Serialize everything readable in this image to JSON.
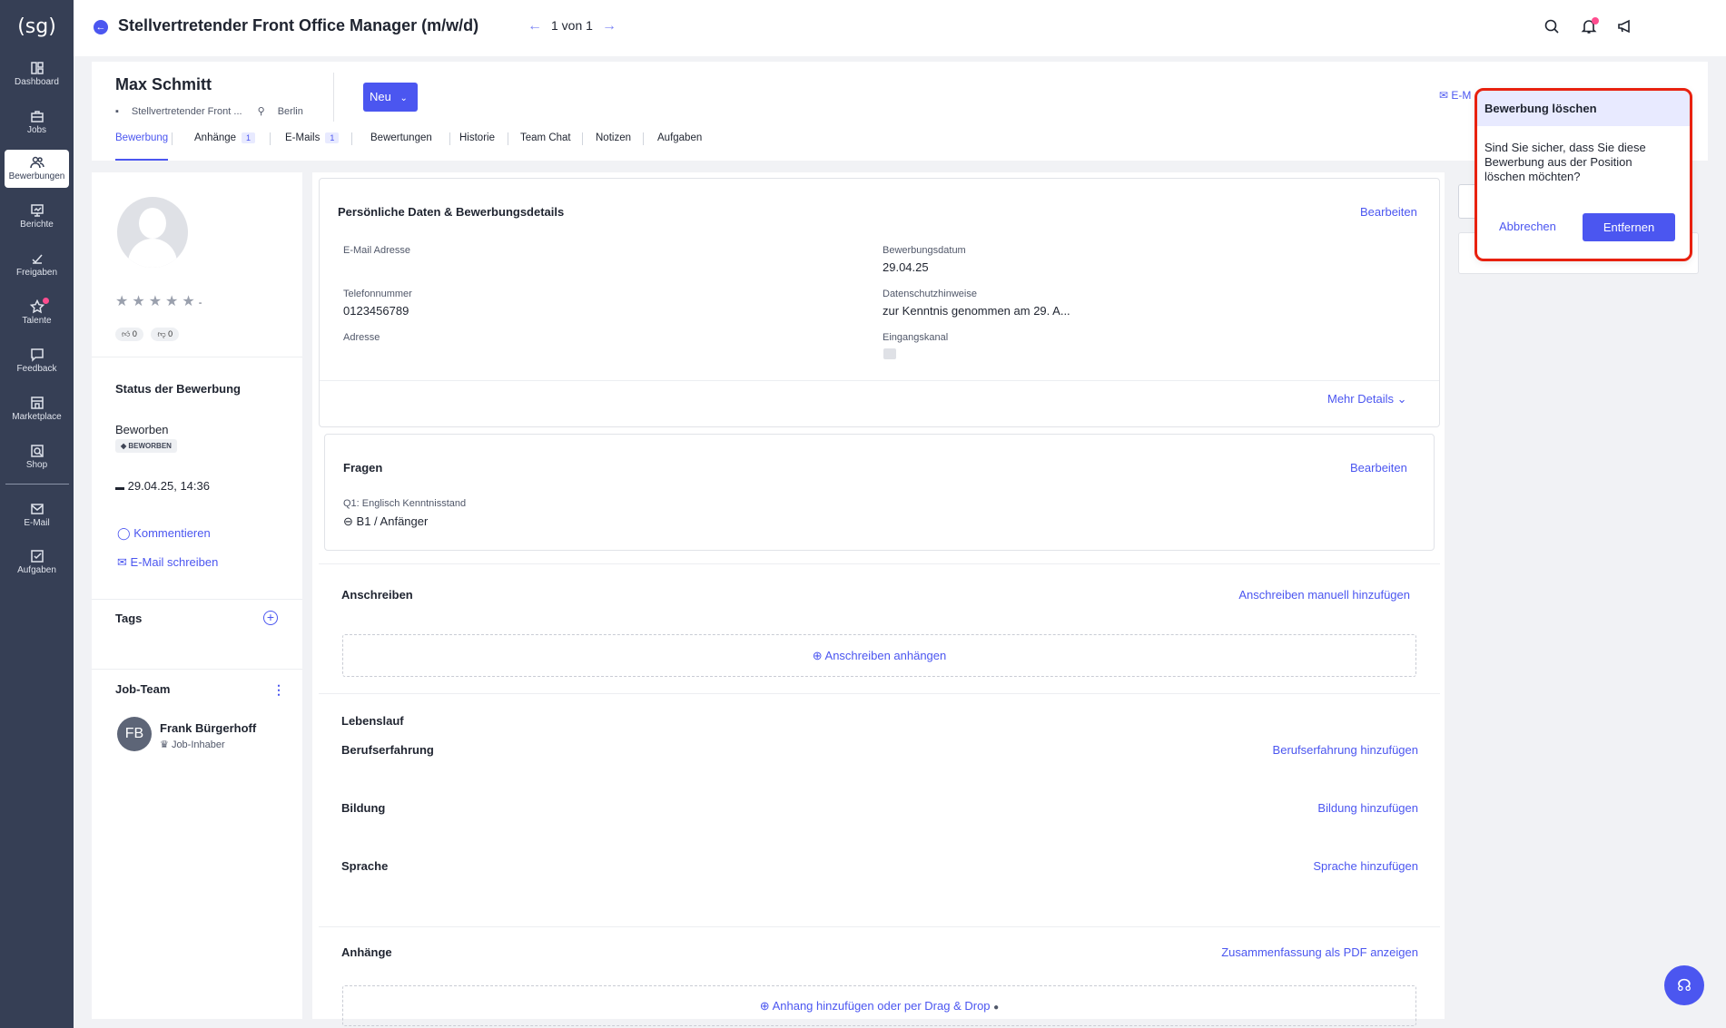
{
  "logo": "(sg)",
  "sidebar": {
    "items": [
      {
        "label": "Dashboard",
        "icon": "dashboard-icon"
      },
      {
        "label": "Jobs",
        "icon": "briefcase-icon"
      },
      {
        "label": "Bewerbungen",
        "icon": "users-icon"
      },
      {
        "label": "Berichte",
        "icon": "chart-icon"
      },
      {
        "label": "Freigaben",
        "icon": "check-icon"
      },
      {
        "label": "Talente",
        "icon": "star-icon"
      },
      {
        "label": "Feedback",
        "icon": "message-icon"
      },
      {
        "label": "Marketplace",
        "icon": "store-icon"
      },
      {
        "label": "Shop",
        "icon": "shop-icon"
      },
      {
        "label": "E-Mail",
        "icon": "mail-icon"
      },
      {
        "label": "Aufgaben",
        "icon": "tasks-icon"
      }
    ],
    "active": "Bewerbungen"
  },
  "topbar": {
    "title": "Stellvertretender Front Office Manager (m/w/d)",
    "pager": "1 von 1"
  },
  "candidate": {
    "name": "Max Schmitt",
    "position": "Stellvertretender Front ...",
    "location": "Berlin",
    "status_button": "Neu",
    "email_link": "E-M"
  },
  "tabs": [
    {
      "label": "Bewerbung",
      "badge": ""
    },
    {
      "label": "Anhänge",
      "badge": "1"
    },
    {
      "label": "E-Mails",
      "badge": "1"
    },
    {
      "label": "Bewertungen",
      "badge": ""
    },
    {
      "label": "Historie",
      "badge": ""
    },
    {
      "label": "Team Chat",
      "badge": ""
    },
    {
      "label": "Notizen",
      "badge": ""
    },
    {
      "label": "Aufgaben",
      "badge": ""
    }
  ],
  "left": {
    "rating_suffix": "-",
    "thumbs_up": "0",
    "thumbs_down": "0",
    "status_title": "Status der Bewerbung",
    "status_value": "Beworben",
    "status_pill": "BEWORBEN",
    "date": "29.04.25, 14:36",
    "comment_link": "Kommentieren",
    "email_link": "E-Mail schreiben",
    "tags_title": "Tags",
    "team_title": "Job-Team",
    "member_initials": "FB",
    "member_name": "Frank Bürgerhoff",
    "member_role": "Job-Inhaber"
  },
  "personal": {
    "title": "Persönliche Daten & Bewerbungsdetails",
    "edit": "Bearbeiten",
    "email_label": "E-Mail Adresse",
    "phone_label": "Telefonnummer",
    "phone_value": "0123456789",
    "address_label": "Adresse",
    "date_label": "Bewerbungsdatum",
    "date_value": "29.04.25",
    "privacy_label": "Datenschutzhinweise",
    "privacy_value": "zur Kenntnis genommen am 29. A...",
    "channel_label": "Eingangskanal",
    "more_details": "Mehr Details"
  },
  "questions": {
    "title": "Fragen",
    "edit": "Bearbeiten",
    "q1_label": "Q1: Englisch Kenntnisstand",
    "q1_value": "B1 / Anfänger"
  },
  "cover": {
    "title": "Anschreiben",
    "add_manual": "Anschreiben manuell hinzufügen",
    "attach": "Anschreiben anhängen"
  },
  "cv": {
    "title": "Lebenslauf",
    "experience": "Berufserfahrung",
    "experience_add": "Berufserfahrung hinzufügen",
    "education": "Bildung",
    "education_add": "Bildung hinzufügen",
    "language": "Sprache",
    "language_add": "Sprache hinzufügen"
  },
  "attachments": {
    "title": "Anhänge",
    "pdf_link": "Zusammenfassung als PDF anzeigen",
    "add": "Anhang hinzufügen oder per Drag & Drop"
  },
  "dialog": {
    "title": "Bewerbung löschen",
    "body": "Sind Sie sicher, dass Sie diese Bewerbung aus der Position löschen möchten?",
    "cancel": "Abbrechen",
    "confirm": "Entfernen"
  },
  "colors": {
    "accent": "#4b56f0",
    "sidebar": "#363f55",
    "highlight": "#e8210f"
  }
}
